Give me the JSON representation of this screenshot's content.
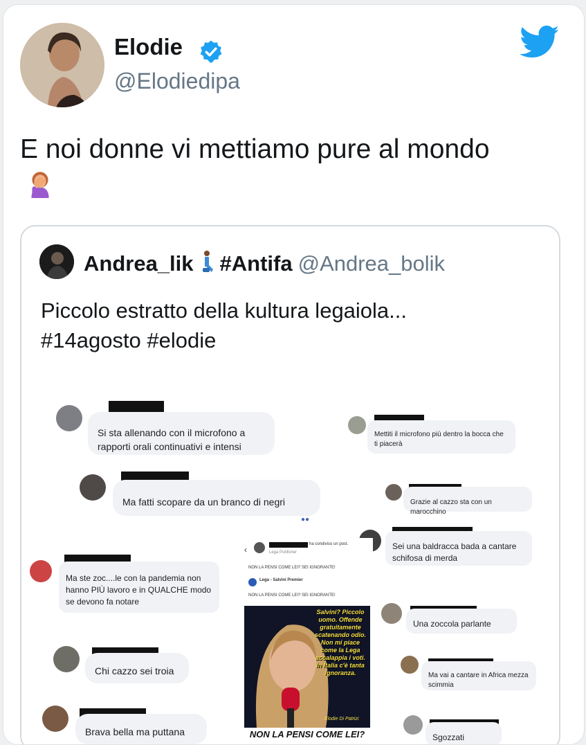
{
  "tweet": {
    "display_name": "Elodie",
    "handle": "@Elodiedipa",
    "text": "E noi donne vi mettiamo pure al mondo",
    "icons": {
      "verified": "verified-badge-icon",
      "logo": "twitter-bird-icon",
      "emoji": "woman-facepalming-emoji"
    }
  },
  "quote": {
    "display_name": "Andrea_lik",
    "tag": "#Antifa",
    "handle": "@Andrea_bolik",
    "text_line1": "Piccolo estratto della kultura legaiola...",
    "text_line2": "#14agosto #elodie",
    "icons": {
      "emoji": "person-kneeling-emoji"
    }
  },
  "collage": {
    "comments": [
      "Si sta allenando con il microfono a rapporti orali  continuativi e intensi",
      "Mettiti il microfono più dentro la bocca che ti piacerà",
      "Ma fatti scopare da un branco di negri",
      "Grazie al cazzo sta con un marocchino",
      "Sei una baldracca bada a cantare schifosa di merda",
      "Ma ste zoc....le con la pandemia non hanno PIÙ  lavoro  e in QUALCHE modo  se  devono fa notare",
      "Una zoccola parlante",
      "Chi cazzo sei troia",
      "Ma vai a cantare in Africa mezza scimmia",
      "Brava bella ma puttana",
      "Sgozzati"
    ],
    "post": {
      "shared_label": "ha condiviso un post.",
      "page1": "Lega Publisher",
      "question1": "NON LA PENSI COME LEI? SEI IGNORANTE!",
      "page2": "Lega - Salvini Premier",
      "question2": "NON LA PENSI COME LEI? SEI IGNORANTE!",
      "quote_text": "Salvini? Piccolo uomo. Offende gratuitamente scatenando odio. Non mi piace come la Lega accalappia i voti. In Italia c'è tanta ignoranza.",
      "signature": "Elodie Di Patrizi",
      "caption": "NON LA PENSI COME LEI?"
    }
  }
}
